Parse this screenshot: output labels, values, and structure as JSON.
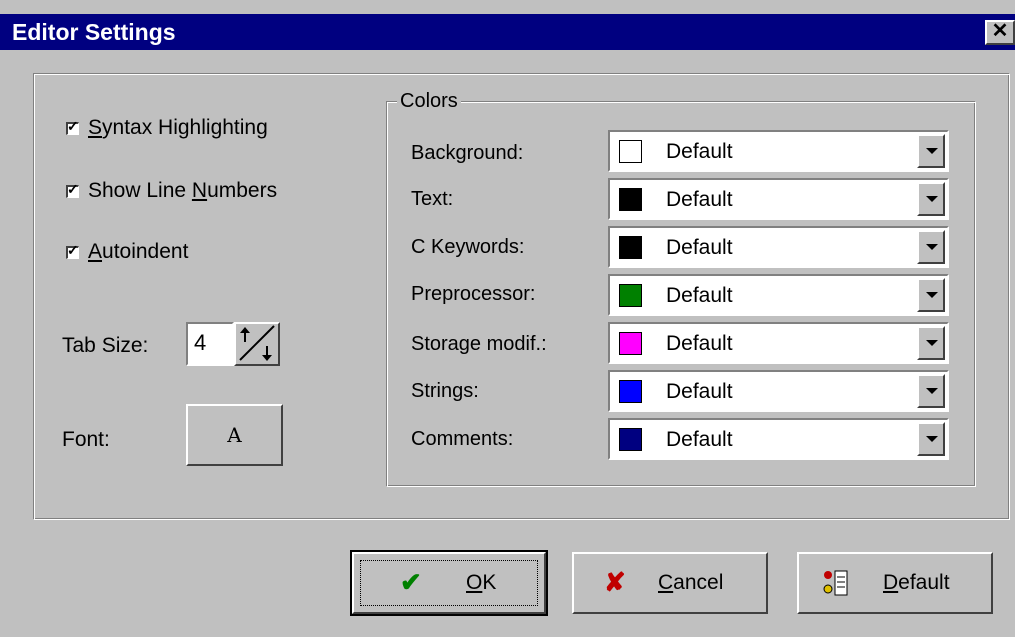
{
  "window": {
    "title": "Editor Settings",
    "close_glyph": "✕"
  },
  "options": {
    "syntax_highlighting": {
      "pre": "",
      "key": "S",
      "post": "yntax Highlighting",
      "checked": true
    },
    "show_line_numbers": {
      "pre": "Show Line ",
      "key": "N",
      "post": "umbers",
      "checked": true
    },
    "autoindent": {
      "pre": "",
      "key": "A",
      "post": "utoindent",
      "checked": true
    },
    "tab_size_label": "Tab Size:",
    "tab_size_value": "4",
    "font_label": "Font:",
    "font_button_label": "A"
  },
  "colors": {
    "group_label": "Colors",
    "rows": [
      {
        "label": "Background:",
        "value": "Default",
        "swatch": "#ffffff"
      },
      {
        "label": "Text:",
        "value": "Default",
        "swatch": "#000000"
      },
      {
        "label": "C Keywords:",
        "value": "Default",
        "swatch": "#000000"
      },
      {
        "label": "Preprocessor:",
        "value": "Default",
        "swatch": "#008000"
      },
      {
        "label": "Storage modif.:",
        "value": "Default",
        "swatch": "#ff00ff"
      },
      {
        "label": "Strings:",
        "value": "Default",
        "swatch": "#0000ff"
      },
      {
        "label": "Comments:",
        "value": "Default",
        "swatch": "#000080"
      }
    ]
  },
  "buttons": {
    "ok": {
      "key": "O",
      "post": "K",
      "icon": "checkmark-icon",
      "icon_color": "#008000"
    },
    "cancel": {
      "key": "C",
      "post": "ancel",
      "icon": "x-icon",
      "icon_color": "#c00000"
    },
    "default": {
      "key": "D",
      "post": "efault",
      "icon": "default-icon"
    }
  }
}
